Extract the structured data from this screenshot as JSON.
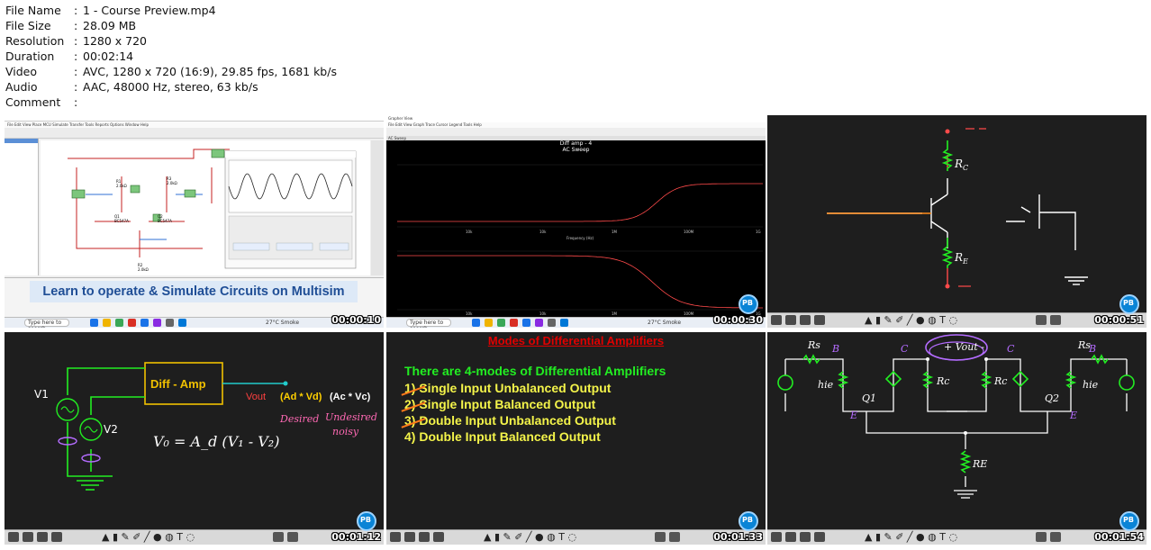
{
  "meta": [
    {
      "key": "File Name",
      "value": "1 - Course Preview.mp4"
    },
    {
      "key": "File Size",
      "value": "28.09 MB"
    },
    {
      "key": "Resolution",
      "value": "1280 x 720"
    },
    {
      "key": "Duration",
      "value": "00:02:14"
    },
    {
      "key": "Video",
      "value": "AVC, 1280 x 720 (16:9), 29.85 fps, 1681 kb/s"
    },
    {
      "key": "Audio",
      "value": "AAC, 48000 Hz, stereo, 63 kb/s"
    },
    {
      "key": "Comment",
      "value": ""
    }
  ],
  "meta_separator": ":",
  "thumbs": [
    {
      "timestamp": "00:00:10",
      "banner": "Learn to operate & Simulate Circuits on Multisim"
    },
    {
      "timestamp": "00:00:30",
      "plot_title": "Diff amp - 4",
      "plot_subtitle": "AC Sweep",
      "xlabel": "Frequency (Hz)"
    },
    {
      "timestamp": "00:00:51",
      "labels": {
        "rc": "R",
        "rc_sub": "C",
        "re": "R",
        "re_sub": "E"
      }
    },
    {
      "timestamp": "00:01:12",
      "box": "Diff - Amp",
      "vout": "Vout",
      "ad": "(Ad * Vd)",
      "ac": "(Ac * Vc)",
      "desired": "Desired",
      "undesired": "Undesired",
      "noisy": "noisy",
      "v1": "V1",
      "v2": "V2",
      "formula": "V₀ = A_d (V₁ - V₂)"
    },
    {
      "timestamp": "00:01:33",
      "heading": "Modes of Differential Amplifiers",
      "subheading": "There are 4-modes of Differential Amplifiers",
      "items": [
        "1) Single Input Unbalanced Output",
        "2) Single Input Balanced Output",
        "3) Double Input Unbalanced Output",
        "4) Double Input Balanced Output"
      ]
    },
    {
      "timestamp": "00:01:54",
      "vout": "+ Vout -",
      "rs": "Rs",
      "rc": "Rc",
      "re": "RE",
      "hie": "hie",
      "q1": "Q1",
      "q2": "Q2",
      "b": "B",
      "c": "C",
      "e": "E"
    }
  ],
  "taskbar": {
    "search": "Type here to search",
    "weather": "27°C Smoke"
  },
  "colors": {
    "board": "#1e1e1e",
    "wire": "#ffffff",
    "green": "#22ee22",
    "yellow": "#f4f44a",
    "red": "#e00000",
    "purple": "#b46cff",
    "orange": "#ff8c1a"
  }
}
